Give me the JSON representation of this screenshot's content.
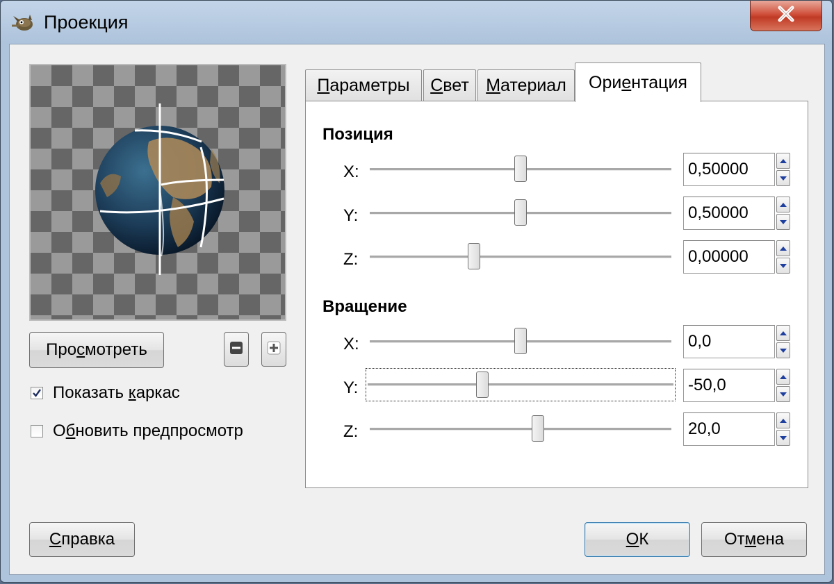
{
  "window": {
    "title": "Проекция",
    "close_symbol": "✕"
  },
  "icons": {
    "app": "gimp-wilber-icon",
    "close": "close-icon",
    "zoom_out": "zoom-out-icon",
    "zoom_in": "zoom-in-icon",
    "spin_up": "chevron-up-icon",
    "spin_down": "chevron-down-icon",
    "check": "checkmark-icon"
  },
  "preview": {
    "preview_button": {
      "before": "Про",
      "mnemonic": "с",
      "after": "мотреть"
    }
  },
  "options": {
    "show_wireframe": {
      "before": "Показать ",
      "mnemonic": "к",
      "after": "аркас",
      "checked": true
    },
    "auto_update": {
      "before": "О",
      "mnemonic": "б",
      "after": "новить предпросмотр",
      "checked": false
    }
  },
  "tabs": [
    {
      "before": "",
      "mnemonic": "П",
      "after": "араметры",
      "active": false
    },
    {
      "before": "",
      "mnemonic": "С",
      "after": "вет",
      "active": false
    },
    {
      "before": "",
      "mnemonic": "М",
      "after": "атериал",
      "active": false
    },
    {
      "before": "Ори",
      "mnemonic": "е",
      "after": "нтация",
      "active": true
    }
  ],
  "orientation": {
    "position": {
      "title": "Позиция",
      "x": {
        "label": "X:",
        "value": "0,50000",
        "fraction": 0.5
      },
      "y": {
        "label": "Y:",
        "value": "0,50000",
        "fraction": 0.5
      },
      "z": {
        "label": "Z:",
        "value": "0,00000",
        "fraction": 0.34
      }
    },
    "rotation": {
      "title": "Вращение",
      "x": {
        "label": "X:",
        "value": "0,0",
        "fraction": 0.5
      },
      "y": {
        "label": "Y:",
        "value": "-50,0",
        "fraction": 0.37
      },
      "z": {
        "label": "Z:",
        "value": "20,0",
        "fraction": 0.56
      }
    }
  },
  "footer": {
    "help": {
      "before": "",
      "mnemonic": "С",
      "after": "правка"
    },
    "ok": {
      "before": "",
      "mnemonic": "О",
      "after": "К"
    },
    "cancel": {
      "before": "От",
      "mnemonic": "м",
      "after": "ена"
    }
  },
  "colors": {
    "title_bar": "#aec4dc",
    "close_button": "#c8432d",
    "dialog_bg": "#f0f0f0",
    "panel_bg": "#ffffff",
    "checker_dark": "#666666",
    "checker_light": "#9a9a9a",
    "spin_arrow": "#1f3f9f"
  }
}
